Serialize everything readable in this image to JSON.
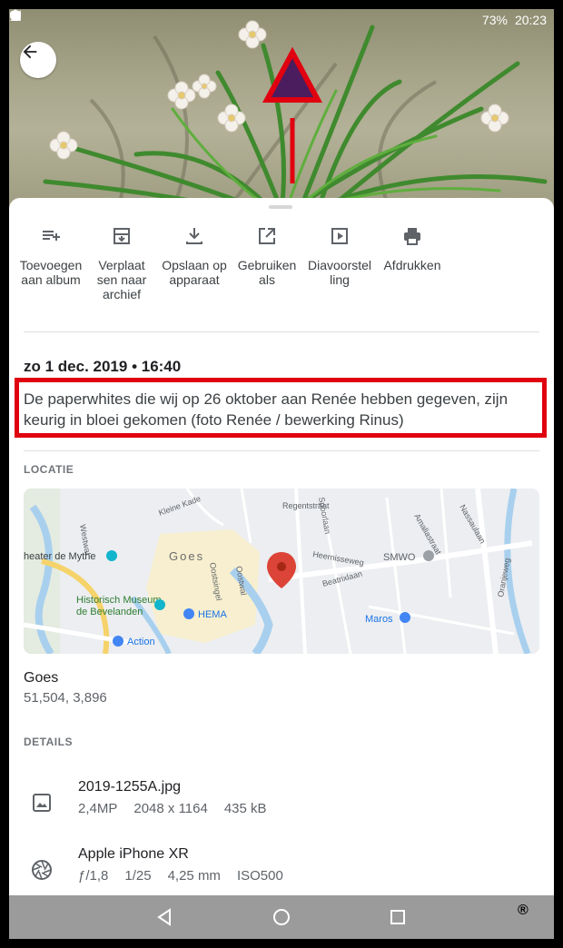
{
  "status_bar": {
    "battery": "73%",
    "time": "20:23"
  },
  "actions": [
    {
      "label": "Toevoegen\naan album",
      "icon": "playlist-add-icon"
    },
    {
      "label": "Verplaat\nsen naar\narchief",
      "icon": "archive-icon"
    },
    {
      "label": "Opslaan op\napparaat",
      "icon": "download-icon"
    },
    {
      "label": "Gebruiken\nals",
      "icon": "open-in-new-icon"
    },
    {
      "label": "Diavoorstel\nling",
      "icon": "slideshow-icon"
    },
    {
      "label": "Afdrukken",
      "icon": "print-icon"
    }
  ],
  "info": {
    "datetime": "zo 1 dec. 2019 • 16:40",
    "description": "De paperwhites die wij op 26 oktober aan Renée hebben gegeven, zijn keurig in bloei gekomen (foto Renée / bewerking Rinus)"
  },
  "location": {
    "heading": "LOCATIE",
    "place": "Goes",
    "coords": "51,504, 3,896",
    "map_labels": {
      "city": "Goes",
      "theater": "heater de Mythe",
      "museum": "Historisch Museum\nde Bevelanden",
      "hema": "HEMA",
      "action": "Action",
      "smwo": "SMWO",
      "maros": "Maros",
      "heernisseweg": "Heernisseweg",
      "beatrixlaan": "Beatrixlaan",
      "oranjeweg": "Oranjeweg",
      "kleine_kade": "Kleine Kade",
      "westwal": "Westwal",
      "oostsingel": "Oostsingel",
      "oostwal": "Oostwal",
      "regentstraat": "Regentstraat",
      "spoorlaan": "Spoorlaan",
      "nassaulaan": "Nassaulaan",
      "amaliastraat": "Amaliastraat"
    }
  },
  "details": {
    "heading": "DETAILS",
    "file": {
      "name": "2019-1255A.jpg",
      "megapixels": "2,4MP",
      "dimensions": "2048 x 1164",
      "size": "435 kB",
      "icon": "image-icon"
    },
    "camera": {
      "name": "Apple iPhone XR",
      "aperture": "ƒ/1,8",
      "shutter": "1/25",
      "focal": "4,25 mm",
      "iso": "ISO500",
      "icon": "camera-aperture-icon"
    }
  },
  "navbar": {
    "mark": "®"
  },
  "colors": {
    "highlight_red": "#e0000f",
    "triangle_fill": "#4b1d5f",
    "map_pin": "#db4437",
    "nav_bg": "#9b9b9b"
  }
}
